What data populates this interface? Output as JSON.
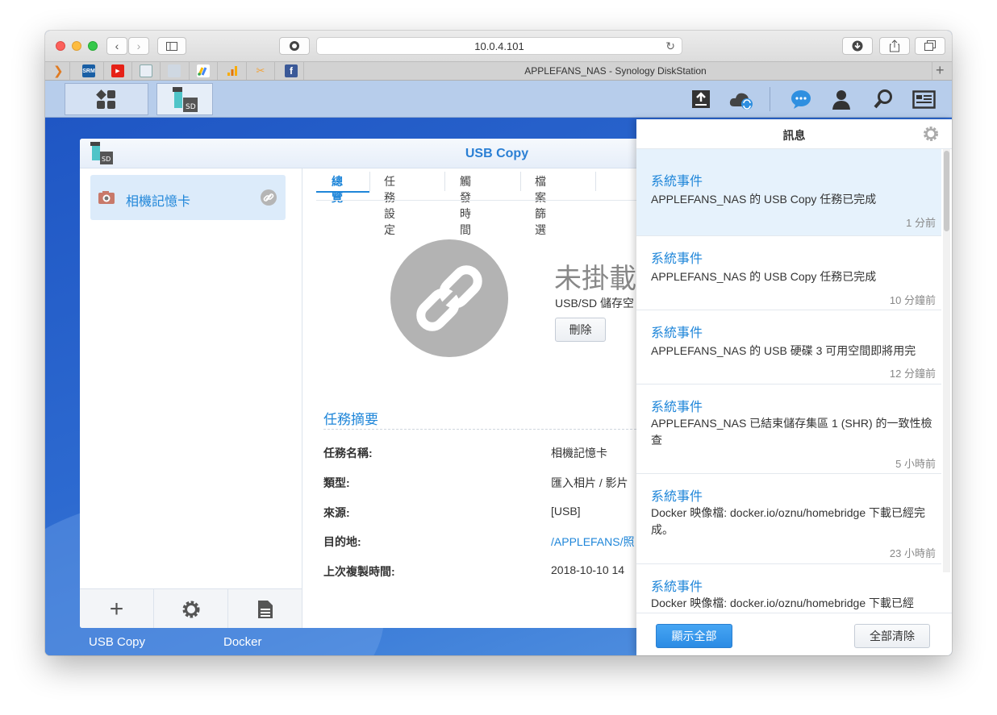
{
  "browser": {
    "url": "10.0.4.101",
    "tab_title": "APPLEFANS_NAS - Synology DiskStation"
  },
  "dock": {
    "usb_copy_label": "USB Copy",
    "docker_label": "Docker"
  },
  "app": {
    "title": "USB Copy",
    "sidebar_item": "相機記憶卡",
    "tabs": [
      "總覽",
      "任務設定",
      "觸發時間",
      "檔案篩選"
    ],
    "status_title": "未掛載",
    "status_sub": "USB/SD 儲存空",
    "delete_button": "刪除",
    "summary_heading": "任務摘要",
    "summary": [
      {
        "label": "任務名稱:",
        "value": "相機記憶卡"
      },
      {
        "label": "類型:",
        "value": "匯入相片 / 影片"
      },
      {
        "label": "來源:",
        "value": "[USB]"
      },
      {
        "label": "目的地:",
        "value": "/APPLEFANS/照"
      },
      {
        "label": "上次複製時間:",
        "value": "2018-10-10 14"
      }
    ]
  },
  "notifications": {
    "title": "訊息",
    "items": [
      {
        "title": "系統事件",
        "message": "APPLEFANS_NAS 的 USB Copy 任務已完成",
        "time": "1 分前"
      },
      {
        "title": "系統事件",
        "message": "APPLEFANS_NAS 的 USB Copy 任務已完成",
        "time": "10 分鐘前"
      },
      {
        "title": "系統事件",
        "message": "APPLEFANS_NAS 的 USB 硬碟 3 可用空間即將用完",
        "time": "12 分鐘前"
      },
      {
        "title": "系統事件",
        "message": "APPLEFANS_NAS 已結束儲存集區 1 (SHR) 的一致性檢查",
        "time": "5 小時前"
      },
      {
        "title": "系統事件",
        "message": "Docker 映像檔: docker.io/oznu/homebridge 下載已經完成。",
        "time": "23 小時前"
      },
      {
        "title": "系統事件",
        "message": "Docker 映像檔: docker.io/oznu/homebridge 下載已經"
      }
    ],
    "show_all": "顯示全部",
    "clear_all": "全部清除"
  },
  "colors": {
    "accent": "#1f86d9",
    "selected": "#dcebfa",
    "taskbar": "#b7cdeb"
  }
}
